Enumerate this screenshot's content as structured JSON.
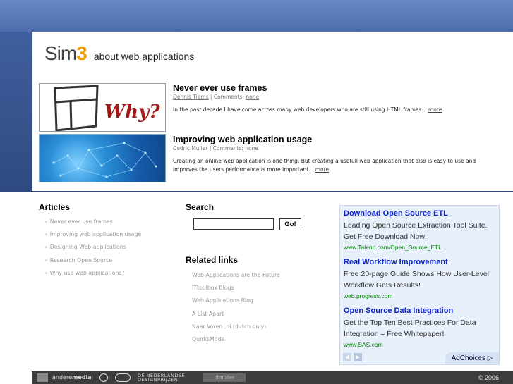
{
  "header": {
    "logo_text": "Sim",
    "logo_digit": "3",
    "tagline": "about web applications"
  },
  "articles": [
    {
      "title": "Never ever use frames",
      "author": "Dennis Tiems",
      "comments_label": "Comments:",
      "comments_value": "none",
      "body": "In the past decade I have come across many web developers who are still using HTML frames...",
      "more": "more",
      "thumb_text": "Why?"
    },
    {
      "title": "Improving web application usage",
      "author": "Cedric Muller",
      "comments_label": "Comments:",
      "comments_value": "none",
      "body": "Creating an online web application is one thing. But creating a usefull web application that also is easy to use and imporves the users performance is more important...",
      "more": "more"
    }
  ],
  "sidebar_articles": {
    "heading": "Articles",
    "items": [
      "Never ever use frames",
      "Improving web application usage",
      "Designing Web applications",
      "Research Open Source",
      "Why use web applications?"
    ]
  },
  "search": {
    "heading": "Search",
    "value": "",
    "button": "Go!"
  },
  "related": {
    "heading": "Related links",
    "items": [
      "Web Applications are the Future",
      "ITtoolbox Blogs",
      "Web Applications Blog",
      "A List Apart",
      "Naar Voren .nl (dutch only)",
      "QuirksMode"
    ]
  },
  "ads": {
    "items": [
      {
        "title": "Download Open Source ETL",
        "text": "Leading Open Source Extraction Tool Suite. Get Free Download Now!",
        "url": "www.Talend.com/Open_Source_ETL"
      },
      {
        "title": "Real Workflow Improvement",
        "text": "Free 20-page Guide Shows How User-Level Workflow Gets Results!",
        "url": "web.progress.com"
      },
      {
        "title": "Open Source Data Integration",
        "text": "Get the Top Ten Best Practices For Data Integration – Free Whitepaper!",
        "url": "www.SAS.com"
      }
    ],
    "adchoices": "AdChoices"
  },
  "footer": {
    "brand_1": "andere",
    "brand_1b": "media",
    "brand_2": "DE NEDERLANDSE DESIGNPRIJZEN",
    "brand_3": "clmuller",
    "copyright": "© 2006"
  }
}
